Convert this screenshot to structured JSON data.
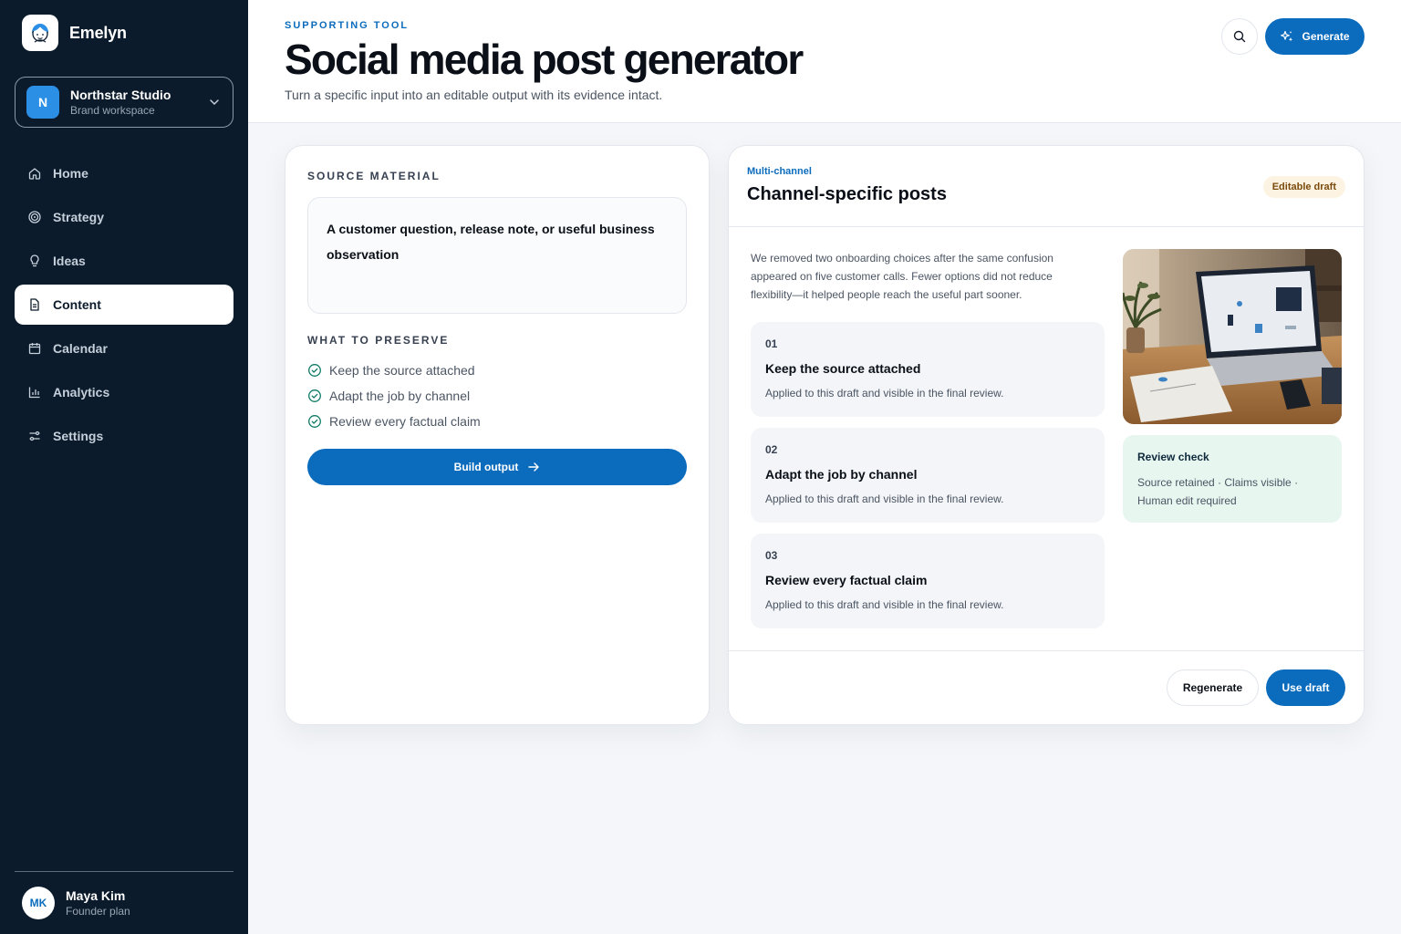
{
  "colors": {
    "accent": "#0b6cbd",
    "sidebar_bg": "#0b1b2b",
    "badge_bg": "#fdf3e2",
    "review_bg": "#e8f6f0"
  },
  "brand": {
    "name": "Emelyn"
  },
  "workspace": {
    "initial": "N",
    "name": "Northstar Studio",
    "subtitle": "Brand workspace"
  },
  "nav": {
    "items": [
      {
        "label": "Home",
        "icon": "home-icon"
      },
      {
        "label": "Strategy",
        "icon": "target-icon"
      },
      {
        "label": "Ideas",
        "icon": "lightbulb-icon"
      },
      {
        "label": "Content",
        "icon": "document-icon",
        "active": true
      },
      {
        "label": "Calendar",
        "icon": "calendar-icon"
      },
      {
        "label": "Analytics",
        "icon": "bar-chart-icon"
      },
      {
        "label": "Settings",
        "icon": "sliders-icon"
      }
    ]
  },
  "user": {
    "initials": "MK",
    "name": "Maya Kim",
    "plan": "Founder plan"
  },
  "header": {
    "eyebrow": "SUPPORTING TOOL",
    "title": "Social media post generator",
    "subtitle": "Turn a specific input into an editable output with its evidence intact.",
    "generate_label": "Generate"
  },
  "source": {
    "label": "SOURCE MATERIAL",
    "text": "A customer question, release note, or useful business observation",
    "preserve_label": "WHAT TO PRESERVE",
    "preserve_items": [
      "Keep the source attached",
      "Adapt the job by channel",
      "Review every factual claim"
    ],
    "build_label": "Build output"
  },
  "output": {
    "eyebrow": "Multi-channel",
    "title": "Channel-specific posts",
    "badge": "Editable draft",
    "body": "We removed two onboarding choices after the same confusion appeared on five customer calls. Fewer options did not reduce flexibility—it helped people reach the useful part sooner.",
    "steps": [
      {
        "num": "01",
        "title": "Keep the source attached",
        "desc": "Applied to this draft and visible in the final review."
      },
      {
        "num": "02",
        "title": "Adapt the job by channel",
        "desc": "Applied to this draft and visible in the final review."
      },
      {
        "num": "03",
        "title": "Review every factual claim",
        "desc": "Applied to this draft and visible in the final review."
      }
    ],
    "review_title": "Review check",
    "review_desc": "Source retained · Claims visible · Human edit required",
    "regenerate_label": "Regenerate",
    "use_label": "Use draft"
  }
}
